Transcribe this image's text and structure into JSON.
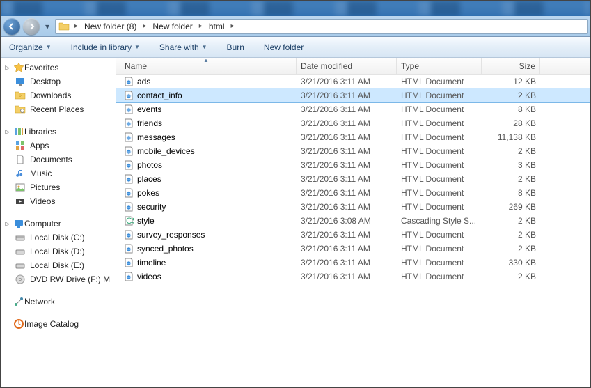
{
  "breadcrumb": {
    "segments": [
      "New folder (8)",
      "New folder",
      "html"
    ]
  },
  "toolbar": {
    "organize": "Organize",
    "include": "Include in library",
    "share": "Share with",
    "burn": "Burn",
    "newfolder": "New folder"
  },
  "columns": {
    "name": "Name",
    "date": "Date modified",
    "type": "Type",
    "size": "Size",
    "sort_col": "name",
    "sort_dir": "asc"
  },
  "sidebar": {
    "favorites": {
      "label": "Favorites",
      "items": [
        {
          "icon": "desktop",
          "label": "Desktop"
        },
        {
          "icon": "downloads",
          "label": "Downloads"
        },
        {
          "icon": "recent",
          "label": "Recent Places"
        }
      ]
    },
    "libraries": {
      "label": "Libraries",
      "items": [
        {
          "icon": "apps",
          "label": "Apps"
        },
        {
          "icon": "documents",
          "label": "Documents"
        },
        {
          "icon": "music",
          "label": "Music"
        },
        {
          "icon": "pictures",
          "label": "Pictures"
        },
        {
          "icon": "videos",
          "label": "Videos"
        }
      ]
    },
    "computer": {
      "label": "Computer",
      "items": [
        {
          "icon": "drive-c",
          "label": "Local Disk (C:)"
        },
        {
          "icon": "drive",
          "label": "Local Disk (D:)"
        },
        {
          "icon": "drive",
          "label": "Local Disk (E:)"
        },
        {
          "icon": "dvd",
          "label": "DVD RW Drive (F:)  M"
        }
      ]
    },
    "network": {
      "label": "Network"
    },
    "image_catalog": {
      "label": "Image Catalog"
    }
  },
  "files": [
    {
      "name": "ads",
      "date": "3/21/2016 3:11 AM",
      "type": "HTML Document",
      "size": "12 KB",
      "kind": "html",
      "selected": false
    },
    {
      "name": "contact_info",
      "date": "3/21/2016 3:11 AM",
      "type": "HTML Document",
      "size": "2 KB",
      "kind": "html",
      "selected": true
    },
    {
      "name": "events",
      "date": "3/21/2016 3:11 AM",
      "type": "HTML Document",
      "size": "8 KB",
      "kind": "html",
      "selected": false
    },
    {
      "name": "friends",
      "date": "3/21/2016 3:11 AM",
      "type": "HTML Document",
      "size": "28 KB",
      "kind": "html",
      "selected": false
    },
    {
      "name": "messages",
      "date": "3/21/2016 3:11 AM",
      "type": "HTML Document",
      "size": "11,138 KB",
      "kind": "html",
      "selected": false
    },
    {
      "name": "mobile_devices",
      "date": "3/21/2016 3:11 AM",
      "type": "HTML Document",
      "size": "2 KB",
      "kind": "html",
      "selected": false
    },
    {
      "name": "photos",
      "date": "3/21/2016 3:11 AM",
      "type": "HTML Document",
      "size": "3 KB",
      "kind": "html",
      "selected": false
    },
    {
      "name": "places",
      "date": "3/21/2016 3:11 AM",
      "type": "HTML Document",
      "size": "2 KB",
      "kind": "html",
      "selected": false
    },
    {
      "name": "pokes",
      "date": "3/21/2016 3:11 AM",
      "type": "HTML Document",
      "size": "8 KB",
      "kind": "html",
      "selected": false
    },
    {
      "name": "security",
      "date": "3/21/2016 3:11 AM",
      "type": "HTML Document",
      "size": "269 KB",
      "kind": "html",
      "selected": false
    },
    {
      "name": "style",
      "date": "3/21/2016 3:08 AM",
      "type": "Cascading Style S...",
      "size": "2 KB",
      "kind": "css",
      "selected": false
    },
    {
      "name": "survey_responses",
      "date": "3/21/2016 3:11 AM",
      "type": "HTML Document",
      "size": "2 KB",
      "kind": "html",
      "selected": false
    },
    {
      "name": "synced_photos",
      "date": "3/21/2016 3:11 AM",
      "type": "HTML Document",
      "size": "2 KB",
      "kind": "html",
      "selected": false
    },
    {
      "name": "timeline",
      "date": "3/21/2016 3:11 AM",
      "type": "HTML Document",
      "size": "330 KB",
      "kind": "html",
      "selected": false
    },
    {
      "name": "videos",
      "date": "3/21/2016 3:11 AM",
      "type": "HTML Document",
      "size": "2 KB",
      "kind": "html",
      "selected": false
    }
  ]
}
